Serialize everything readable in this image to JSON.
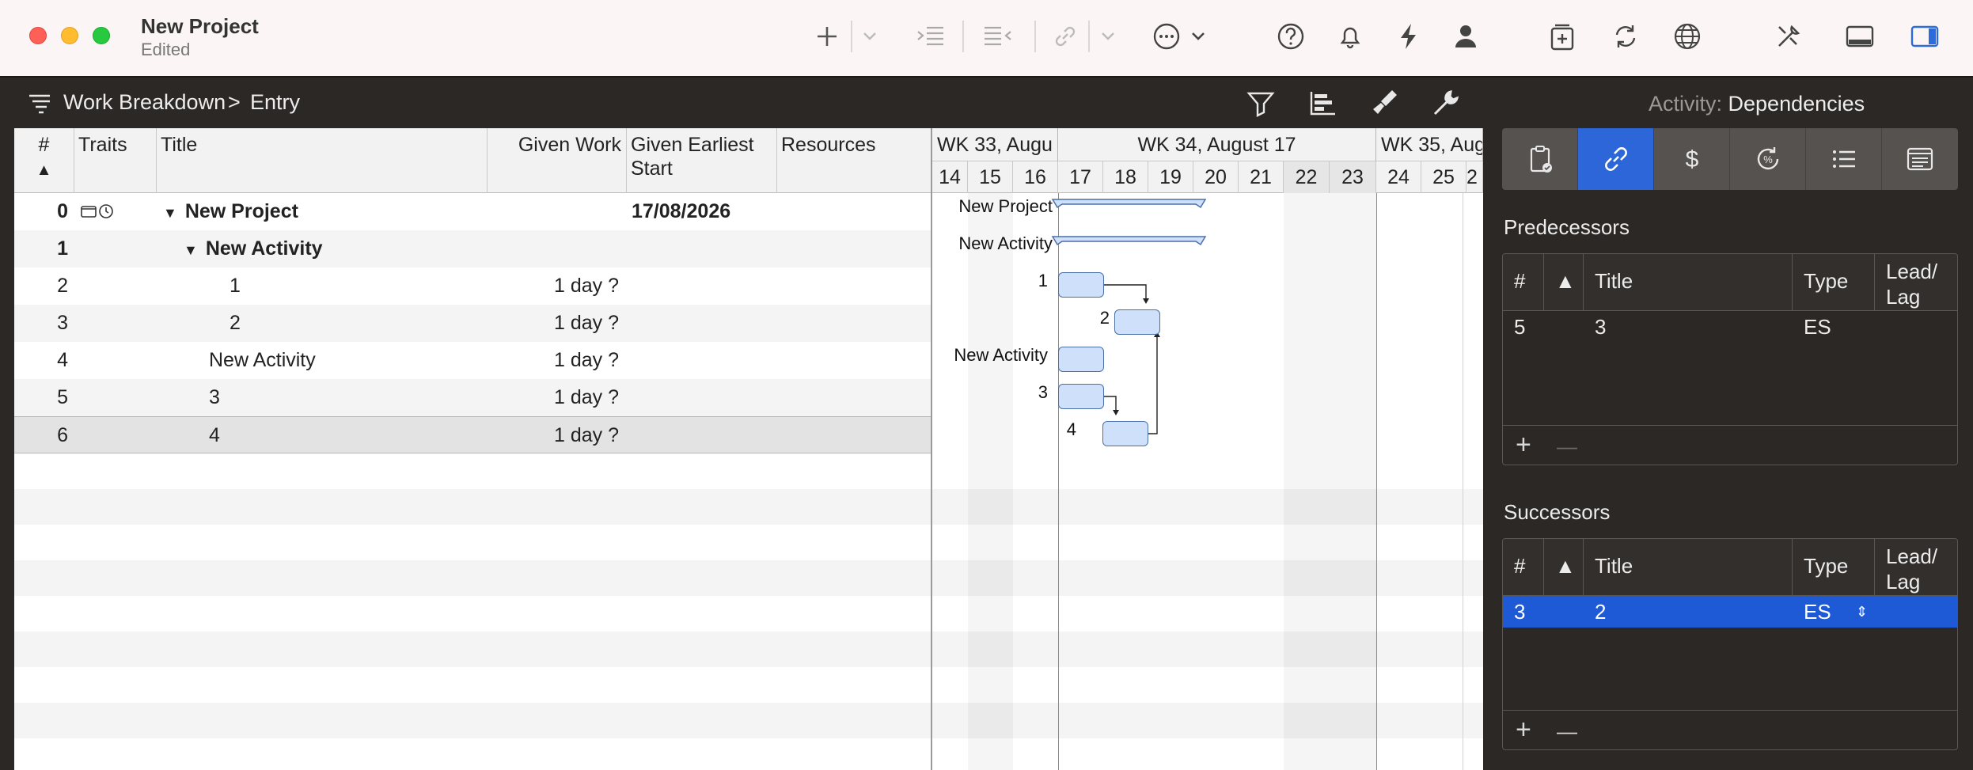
{
  "window": {
    "title": "New Project",
    "status": "Edited"
  },
  "toolbar": {
    "icons": [
      "plus-icon",
      "chevron-down-icon",
      "indent-icon",
      "outdent-icon",
      "link-icon",
      "chevron-down-icon",
      "more-icon",
      "chevron-down-icon",
      "help-icon",
      "bell-icon",
      "bolt-icon",
      "person-icon",
      "add-to-calendar-icon",
      "sync-icon",
      "globe-icon",
      "tools-icon",
      "bottom-panel-icon",
      "side-panel-icon"
    ]
  },
  "breadcrumb": {
    "first": "Work Breakdown",
    "separator": ">",
    "second": "Entry"
  },
  "inspector": {
    "title_prefix": "Activity:",
    "title_value": "Dependencies",
    "tabs": [
      "clipboard-icon",
      "link-icon",
      "dollar-icon",
      "percent-icon",
      "list-icon",
      "notes-icon"
    ],
    "predecessors": {
      "label": "Predecessors",
      "columns": {
        "num": "#",
        "title": "Title",
        "type": "Type",
        "lead_lag": "Lead/ Lag"
      },
      "rows": [
        {
          "num": "5",
          "title": "3",
          "type": "ES",
          "lead_lag": ""
        }
      ],
      "add": "+",
      "remove": "—"
    },
    "successors": {
      "label": "Successors",
      "columns": {
        "num": "#",
        "title": "Title",
        "type": "Type",
        "lead_lag": "Lead/ Lag"
      },
      "rows": [
        {
          "num": "3",
          "title": "2",
          "type": "ES",
          "lead_lag": ""
        }
      ],
      "add": "+",
      "remove": "—"
    }
  },
  "table": {
    "columns": {
      "num": "#",
      "traits": "Traits",
      "title": "Title",
      "given_work": "Given Work",
      "earliest_start": "Given Earliest Start",
      "resources": "Resources"
    },
    "sort_indicator": "▲",
    "rows": [
      {
        "num": "0",
        "title": "New Project",
        "work": "",
        "start": "17/08/2026"
      },
      {
        "num": "1",
        "title": "New Activity",
        "work": "",
        "start": ""
      },
      {
        "num": "2",
        "title": "1",
        "work": "1 day ?",
        "start": ""
      },
      {
        "num": "3",
        "title": "2",
        "work": "1 day ?",
        "start": ""
      },
      {
        "num": "4",
        "title": "New Activity",
        "work": "1 day ?",
        "start": ""
      },
      {
        "num": "5",
        "title": "3",
        "work": "1 day ?",
        "start": ""
      },
      {
        "num": "6",
        "title": "4",
        "work": "1 day ?",
        "start": ""
      }
    ]
  },
  "gantt": {
    "weeks": [
      "WK 33, Augu",
      "WK 34, August 17",
      "WK 35, Aug"
    ],
    "days": [
      "14",
      "15",
      "16",
      "17",
      "18",
      "19",
      "20",
      "21",
      "22",
      "23",
      "24",
      "25",
      "2"
    ],
    "labels": [
      "New Project",
      "New Activity",
      "1",
      "2",
      "New Activity",
      "3",
      "4"
    ]
  }
}
